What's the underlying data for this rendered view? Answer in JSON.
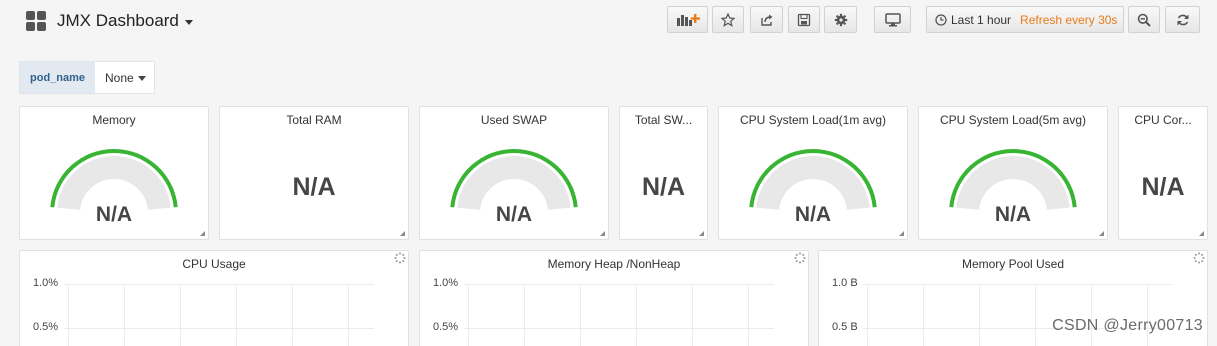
{
  "header": {
    "title": "JMX Dashboard",
    "time_range": "Last 1 hour",
    "refresh": "Refresh every 30s"
  },
  "variables": [
    {
      "name": "pod_name",
      "value": "None"
    }
  ],
  "stat_panels": [
    {
      "title": "Memory",
      "value": "N/A",
      "kind": "gauge"
    },
    {
      "title": "Total RAM",
      "value": "N/A",
      "kind": "singlestat"
    },
    {
      "title": "Used SWAP",
      "value": "N/A",
      "kind": "gauge"
    },
    {
      "title": "Total SW...",
      "value": "N/A",
      "kind": "singlestat"
    },
    {
      "title": "CPU System Load(1m avg)",
      "value": "N/A",
      "kind": "gauge"
    },
    {
      "title": "CPU System Load(5m avg)",
      "value": "N/A",
      "kind": "gauge"
    },
    {
      "title": "CPU Cor...",
      "value": "N/A",
      "kind": "singlestat"
    }
  ],
  "graph_panels": [
    {
      "title": "CPU Usage",
      "y_ticks": [
        "1.0%",
        "0.5%"
      ]
    },
    {
      "title": "Memory Heap /NonHeap",
      "y_ticks": [
        "1.0%",
        "0.5%"
      ]
    },
    {
      "title": "Memory Pool Used",
      "y_ticks": [
        "1.0 B",
        "0.5 B"
      ]
    }
  ],
  "colors": {
    "gauge_threshold": "#37b431",
    "gauge_background": "#e8e8e8",
    "refresh_text": "#eb7b18",
    "variable_label": "#31618e"
  },
  "watermark": "CSDN @Jerry00713"
}
